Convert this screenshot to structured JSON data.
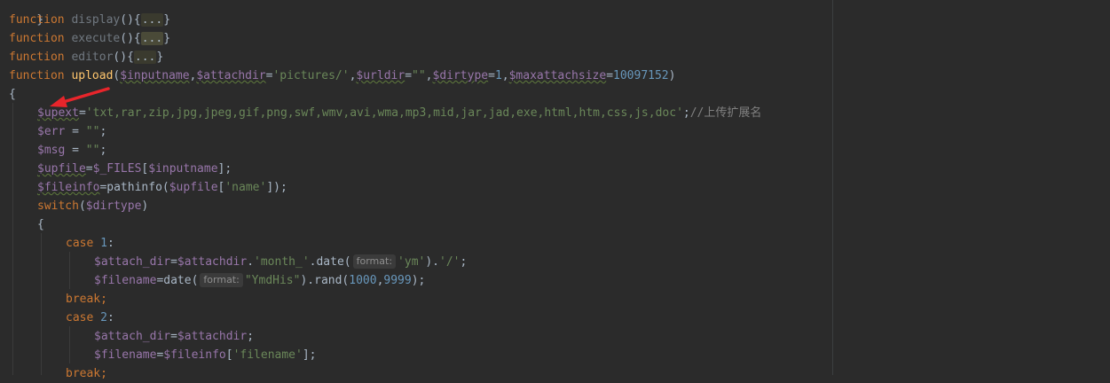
{
  "editor": {
    "language": "php",
    "theme": "darcula",
    "lines": {
      "l0": "}",
      "fold_display": {
        "kw": "function",
        "name": "display",
        "paren": "()",
        "brace": "{",
        "dots": "...",
        "close": "}"
      },
      "fold_execute": {
        "kw": "function",
        "name": "execute",
        "paren": "()",
        "brace": "{",
        "dots": "...",
        "close": "}"
      },
      "fold_editor": {
        "kw": "function",
        "name": "editor",
        "paren": "()",
        "brace": "{",
        "dots": "...",
        "close": "}"
      },
      "upload": {
        "kw": "function",
        "name": "upload",
        "p_open": "(",
        "v1": "$inputname",
        "c1": ",",
        "v2": "$attachdir",
        "eq2": "=",
        "s2": "'pictures/'",
        "c2": ",",
        "v3": "$urldir",
        "eq3": "=",
        "s3": "\"\"",
        "c3": ",",
        "v4": "$dirtype",
        "eq4": "=",
        "n4": "1",
        "c4": ",",
        "v5": "$maxattachsize",
        "eq5": "=",
        "n5": "10097152",
        "p_close": ")"
      },
      "brace_open": "{",
      "upext": {
        "v": "$upext",
        "eq": "=",
        "s": "'txt,rar,zip,jpg,jpeg,gif,png,swf,wmv,avi,wma,mp3,mid,jar,jad,exe,html,htm,css,js,doc'",
        "semi": ";",
        "comment": "//上传扩展名"
      },
      "err": {
        "v": "$err",
        "eq": " = ",
        "s": "\"\"",
        "semi": ";"
      },
      "msg": {
        "v": "$msg",
        "eq": " = ",
        "s": "\"\"",
        "semi": ";"
      },
      "upfile": {
        "v": "$upfile",
        "eq": "=",
        "g": "$_FILES",
        "b1": "[",
        "v2": "$inputname",
        "b2": "];"
      },
      "fileinfo": {
        "v": "$fileinfo",
        "eq": "=pathinfo(",
        "v2": "$upfile",
        "b1": "[",
        "s": "'name'",
        "b2": "]);"
      },
      "switch": {
        "kw": "switch",
        "p1": "(",
        "v": "$dirtype",
        "p2": ")"
      },
      "sw_brace": "{",
      "case1": {
        "kw": "case",
        "n": "1",
        "colon": ":"
      },
      "attach1": {
        "v": "$attach_dir",
        "eq": "=",
        "v2": "$attachdir",
        "dot": ".",
        "s": "'month_'",
        "call": ".date(",
        "hint": "format:",
        "s2": "'ym'",
        "rest": ").",
        "s3": "'/'",
        "semi": ";"
      },
      "filename1": {
        "v": "$filename",
        "call": "=date(",
        "hint": "format:",
        "s": "\"YmdHis\"",
        "mid": ").rand(",
        "n1": "1000",
        "comma": ",",
        "n2": "9999",
        "end": ");"
      },
      "break1": "break;",
      "case2": {
        "kw": "case",
        "n": "2",
        "colon": ":"
      },
      "attach2": {
        "v": "$attach_dir",
        "eq": "=",
        "v2": "$attachdir",
        "semi": ";"
      },
      "filename2": {
        "v": "$filename",
        "eq": "=",
        "v2": "$fileinfo",
        "b1": "[",
        "s": "'filename'",
        "b2": "];"
      },
      "break2": "break;"
    },
    "annotation": {
      "icon": "red-arrow",
      "color": "#e8252b"
    }
  }
}
